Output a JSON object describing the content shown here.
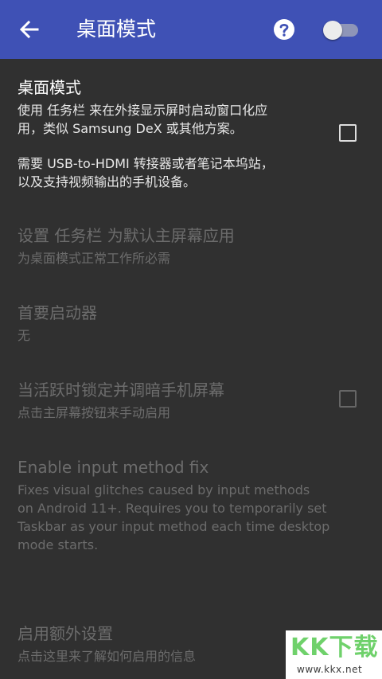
{
  "appbar": {
    "title": "桌面模式",
    "back_icon": "arrow-back-icon",
    "help_icon": "help-circle-icon",
    "toggle_on": false,
    "background": "#3f51b5"
  },
  "prefs": {
    "desktop_mode": {
      "title": "桌面模式",
      "summary_line1": "使用 任务栏 来在外接显示屏时启动窗口化应",
      "summary_line2": "用，类似 Samsung DeX 或其他方案。",
      "summary_line3": "需要 USB-to-HDMI 转接器或者笔记本坞站，",
      "summary_line4": "以及支持视频输出的手机设备。",
      "checked": false
    },
    "default_home": {
      "title": "设置 任务栏 为默认主屏幕应用",
      "summary": "为桌面模式正常工作所必需"
    },
    "primary_launcher": {
      "title": "首要启动器",
      "summary": "无"
    },
    "dim_screen": {
      "title": "当活跃时锁定并调暗手机屏幕",
      "summary": "点击主屏幕按钮来手动启用",
      "checked": false
    },
    "input_method_fix": {
      "title": "Enable input method fix",
      "summary_line1": "Fixes visual glitches caused by input methods",
      "summary_line2": "on Android 11+. Requires you to temporarily set",
      "summary_line3": "Taskbar as your input method each time desktop",
      "summary_line4": "mode starts."
    },
    "extra_settings": {
      "title": "启用额外设置",
      "summary": "点击这里来了解如何启用的信息"
    }
  },
  "watermark": {
    "logo": "KK下载",
    "url": "www.kkx.net"
  }
}
